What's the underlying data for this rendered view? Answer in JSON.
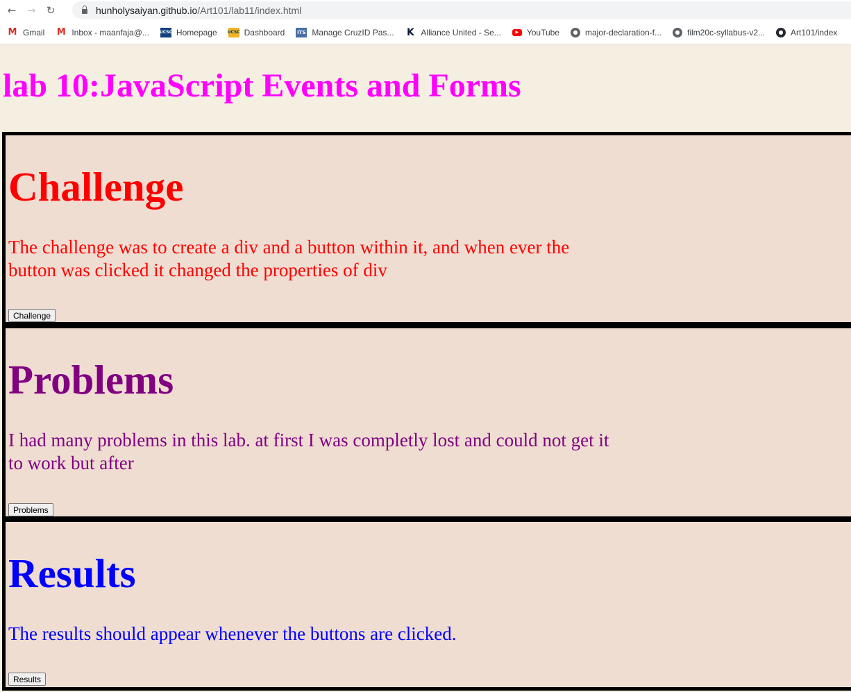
{
  "browser": {
    "url_host": "hunholysaiyan.github.io",
    "url_path": "/Art101/lab11/index.html",
    "bookmarks": [
      {
        "label": "Gmail",
        "icon": "gmail-icon"
      },
      {
        "label": "Inbox - maanfaja@...",
        "icon": "gmail-icon"
      },
      {
        "label": "Homepage",
        "icon": "ucsc-icon"
      },
      {
        "label": "Dashboard",
        "icon": "ucsc-icon"
      },
      {
        "label": "Manage CruzID Pas...",
        "icon": "its-icon"
      },
      {
        "label": "Alliance United - Se...",
        "icon": "k-icon"
      },
      {
        "label": "YouTube",
        "icon": "youtube-icon"
      },
      {
        "label": "major-declaration-f...",
        "icon": "globe-icon"
      },
      {
        "label": "film20c-syllabus-v2...",
        "icon": "globe-icon"
      },
      {
        "label": "Art101/index",
        "icon": "github-icon"
      }
    ]
  },
  "page": {
    "title": "lab 10:JavaScript Events and Forms",
    "title_color": "#ff00ff",
    "background": "#f5efe1",
    "sections": [
      {
        "heading": "Challenge",
        "text": "The challenge was to create a div and a button within it, and when ever the button was clicked it changed the properties of div",
        "button_label": "Challenge",
        "color": "#ff0000"
      },
      {
        "heading": "Problems",
        "text": "I had many problems in this lab. at first I was completly lost and could not get it to work but after",
        "button_label": "Problems",
        "color": "#800080"
      },
      {
        "heading": "Results",
        "text": "The results should appear whenever the buttons are clicked.",
        "button_label": "Results",
        "color": "#0000ff"
      }
    ]
  }
}
